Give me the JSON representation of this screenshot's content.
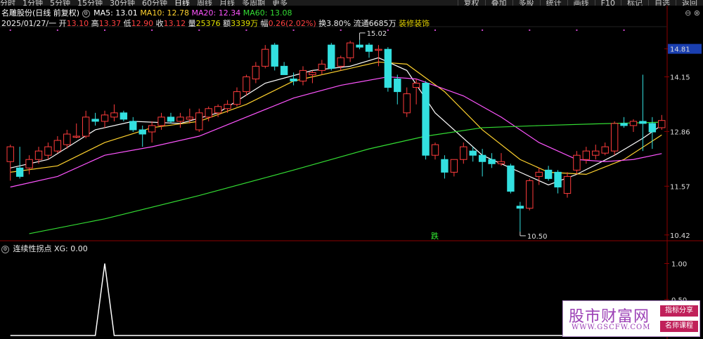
{
  "periods": [
    "分时",
    "1分钟",
    "5分钟",
    "15分钟",
    "30分钟",
    "60分钟",
    "日线",
    "周线",
    "月线",
    "多周期",
    "更多"
  ],
  "active_period": 6,
  "toolbar_buttons": [
    "复权",
    "叠加",
    "多股",
    "统计",
    "画线",
    "F10",
    "标记",
    "自选",
    "返回"
  ],
  "stock": {
    "name": "名雕股份(日线 前复权)",
    "ma5": "MA5: 13.01",
    "ma10": "MA10: 12.78",
    "ma20": "MA20: 12.34",
    "ma60": "MA60: 13.08",
    "date": "2025/01/27/一",
    "open_l": "开",
    "open": "13.10",
    "high_l": "高",
    "high": "13.37",
    "low_l": "低",
    "low": "12.90",
    "close_l": "收",
    "close": "13.12",
    "vol_l": "量",
    "vol": "25376",
    "amt_l": "额",
    "amt": "3339万",
    "chg_l": "幅",
    "chg": "0.26(2.02%)",
    "turn_l": "换",
    "turn": "3.80%",
    "float_l": "流通",
    "float": "6685万",
    "sector": "装修装饰"
  },
  "lower": {
    "name": "连续性拐点",
    "xg": "XG: 0.00"
  },
  "colors": {
    "up": "#ff3c3c",
    "down": "#33e0e0",
    "ma5": "#ffffff",
    "ma10": "#ffd22e",
    "ma20": "#ff55ff",
    "ma60": "#33dd33"
  },
  "chart_data": {
    "type": "candlestick",
    "y_ticks": [
      "14.81",
      "14.15",
      "12.86",
      "11.57",
      "10.42"
    ],
    "current_price_label": "14.81",
    "ylim": [
      10.3,
      15.3
    ],
    "annotations": [
      {
        "text": "15.02",
        "price": 15.02,
        "kind": "high"
      },
      {
        "text": "10.50",
        "price": 10.5,
        "kind": "low"
      },
      {
        "text": "跌",
        "kind": "signal"
      }
    ],
    "candles": [
      [
        12.15,
        12.55,
        11.7,
        12.5
      ],
      [
        12.0,
        12.5,
        11.75,
        11.8
      ],
      [
        12.0,
        12.3,
        11.85,
        12.2
      ],
      [
        12.2,
        12.5,
        12.1,
        12.4
      ],
      [
        12.3,
        12.6,
        12.2,
        12.5
      ],
      [
        12.4,
        12.75,
        12.35,
        12.65
      ],
      [
        12.55,
        12.9,
        12.45,
        12.8
      ],
      [
        12.75,
        13.05,
        12.7,
        12.75
      ],
      [
        12.75,
        13.35,
        12.7,
        13.2
      ],
      [
        13.15,
        13.3,
        13.0,
        13.1
      ],
      [
        13.1,
        13.35,
        12.95,
        13.25
      ],
      [
        13.2,
        13.5,
        13.1,
        13.3
      ],
      [
        13.3,
        13.35,
        13.1,
        13.15
      ],
      [
        13.1,
        13.2,
        12.85,
        12.9
      ],
      [
        12.9,
        13.0,
        12.5,
        12.8
      ],
      [
        12.85,
        13.1,
        12.6,
        13.0
      ],
      [
        13.0,
        13.3,
        12.9,
        13.2
      ],
      [
        13.2,
        13.3,
        13.05,
        13.1
      ],
      [
        13.1,
        13.3,
        12.95,
        13.2
      ],
      [
        13.15,
        13.4,
        13.05,
        13.2
      ],
      [
        12.9,
        13.4,
        12.85,
        13.3
      ],
      [
        13.2,
        13.45,
        13.1,
        13.4
      ],
      [
        13.3,
        13.5,
        13.2,
        13.45
      ],
      [
        13.4,
        13.6,
        13.3,
        13.5
      ],
      [
        13.5,
        13.9,
        13.45,
        13.8
      ],
      [
        13.8,
        14.2,
        13.7,
        14.15
      ],
      [
        14.1,
        14.5,
        14.0,
        14.4
      ],
      [
        14.4,
        14.9,
        14.35,
        14.8
      ],
      [
        14.9,
        14.95,
        14.3,
        14.4
      ],
      [
        14.4,
        14.5,
        14.2,
        14.2
      ],
      [
        14.1,
        14.25,
        13.95,
        14.05
      ],
      [
        14.05,
        14.4,
        13.95,
        14.3
      ],
      [
        14.2,
        14.3,
        14.0,
        14.25
      ],
      [
        14.3,
        14.55,
        14.2,
        14.45
      ],
      [
        14.9,
        14.95,
        14.3,
        14.35
      ],
      [
        14.4,
        14.65,
        14.3,
        14.6
      ],
      [
        14.6,
        15.0,
        14.5,
        14.95
      ],
      [
        14.9,
        15.02,
        14.8,
        14.85
      ],
      [
        14.9,
        14.95,
        14.6,
        14.75
      ],
      [
        14.8,
        14.9,
        14.4,
        14.8
      ],
      [
        14.8,
        14.85,
        13.8,
        13.9
      ],
      [
        14.1,
        14.2,
        13.5,
        13.8
      ],
      [
        13.3,
        13.9,
        13.2,
        13.75
      ],
      [
        13.9,
        14.1,
        13.5,
        14.0
      ],
      [
        14.0,
        14.05,
        12.2,
        12.3
      ],
      [
        12.3,
        12.6,
        12.2,
        12.55
      ],
      [
        12.2,
        12.3,
        11.75,
        11.9
      ],
      [
        11.9,
        12.2,
        11.8,
        12.2
      ],
      [
        12.2,
        12.6,
        12.1,
        12.5
      ],
      [
        12.4,
        12.5,
        12.15,
        12.3
      ],
      [
        12.3,
        12.45,
        11.8,
        12.15
      ],
      [
        12.2,
        12.35,
        12.0,
        12.1
      ],
      [
        12.1,
        12.35,
        12.05,
        12.15
      ],
      [
        12.05,
        12.1,
        11.4,
        11.45
      ],
      [
        11.1,
        11.2,
        10.5,
        11.05
      ],
      [
        11.05,
        11.75,
        11.0,
        11.7
      ],
      [
        11.8,
        12.0,
        11.6,
        11.9
      ],
      [
        11.95,
        12.05,
        11.7,
        11.75
      ],
      [
        11.9,
        11.95,
        11.4,
        11.55
      ],
      [
        11.4,
        11.9,
        11.3,
        11.8
      ],
      [
        11.95,
        12.4,
        11.85,
        12.3
      ],
      [
        12.2,
        12.5,
        12.1,
        12.4
      ],
      [
        12.3,
        12.55,
        12.2,
        12.4
      ],
      [
        12.35,
        12.6,
        12.3,
        12.5
      ],
      [
        12.4,
        13.1,
        12.3,
        13.05
      ],
      [
        13.05,
        13.2,
        12.95,
        13.0
      ],
      [
        13.0,
        13.15,
        12.85,
        13.1
      ],
      [
        13.1,
        14.2,
        12.4,
        13.05
      ],
      [
        13.05,
        13.2,
        12.45,
        12.85
      ],
      [
        12.95,
        13.25,
        12.9,
        13.12
      ]
    ],
    "ma_series": [
      {
        "name": "MA5",
        "color": "#ffffff",
        "points": [
          [
            0,
            12.0
          ],
          [
            4,
            12.2
          ],
          [
            9,
            12.9
          ],
          [
            13,
            13.1
          ],
          [
            18,
            13.05
          ],
          [
            22,
            13.3
          ],
          [
            27,
            14.0
          ],
          [
            32,
            14.3
          ],
          [
            36,
            14.4
          ],
          [
            39,
            14.6
          ],
          [
            42,
            14.3
          ],
          [
            45,
            13.3
          ],
          [
            50,
            12.3
          ],
          [
            54,
            11.9
          ],
          [
            57,
            11.6
          ],
          [
            60,
            11.85
          ],
          [
            64,
            12.3
          ],
          [
            67,
            12.7
          ],
          [
            69,
            13.01
          ]
        ]
      },
      {
        "name": "MA10",
        "color": "#ffd22e",
        "points": [
          [
            0,
            11.9
          ],
          [
            5,
            12.05
          ],
          [
            10,
            12.6
          ],
          [
            15,
            12.95
          ],
          [
            20,
            13.1
          ],
          [
            25,
            13.5
          ],
          [
            30,
            14.05
          ],
          [
            35,
            14.3
          ],
          [
            39,
            14.5
          ],
          [
            42,
            14.45
          ],
          [
            46,
            13.8
          ],
          [
            50,
            12.9
          ],
          [
            54,
            12.2
          ],
          [
            57,
            11.9
          ],
          [
            61,
            11.85
          ],
          [
            65,
            12.2
          ],
          [
            69,
            12.78
          ]
        ]
      },
      {
        "name": "MA20",
        "color": "#ff55ff",
        "points": [
          [
            0,
            11.55
          ],
          [
            5,
            11.8
          ],
          [
            10,
            12.3
          ],
          [
            15,
            12.5
          ],
          [
            20,
            12.75
          ],
          [
            25,
            13.2
          ],
          [
            30,
            13.65
          ],
          [
            35,
            13.95
          ],
          [
            40,
            14.15
          ],
          [
            43,
            14.1
          ],
          [
            48,
            13.7
          ],
          [
            52,
            13.2
          ],
          [
            56,
            12.6
          ],
          [
            60,
            12.2
          ],
          [
            63,
            12.15
          ],
          [
            66,
            12.2
          ],
          [
            69,
            12.34
          ]
        ]
      },
      {
        "name": "MA60",
        "color": "#33dd33",
        "points": [
          [
            2,
            10.45
          ],
          [
            10,
            10.8
          ],
          [
            20,
            11.35
          ],
          [
            30,
            11.95
          ],
          [
            38,
            12.45
          ],
          [
            44,
            12.75
          ],
          [
            50,
            12.95
          ],
          [
            56,
            13.0
          ],
          [
            62,
            13.04
          ],
          [
            69,
            13.08
          ]
        ]
      }
    ],
    "indicator": {
      "name": "XG",
      "y_ticks": [
        "1.00",
        "0.50"
      ],
      "ylim": [
        0,
        1.2
      ],
      "values": [
        0,
        0,
        0,
        0,
        0,
        0,
        0,
        0,
        0,
        0,
        0,
        0,
        0,
        0,
        0,
        0,
        0,
        0,
        0,
        0,
        0,
        0,
        0,
        0,
        0,
        0,
        0,
        0,
        0,
        0,
        0,
        0,
        0,
        0,
        0,
        0,
        0,
        0,
        0,
        0,
        0,
        0,
        0,
        0,
        0,
        0,
        0,
        0,
        0,
        0,
        0,
        0,
        0,
        0,
        0,
        0,
        0,
        0,
        0,
        0,
        0,
        0,
        0,
        0,
        0,
        0,
        0,
        0,
        0,
        0,
        0
      ],
      "peak_index": 10
    }
  },
  "watermark": {
    "title": "股市财富网",
    "url": "WWW.GSCFW.COM",
    "tag1": "指标分享",
    "tag2": "名师课程"
  }
}
